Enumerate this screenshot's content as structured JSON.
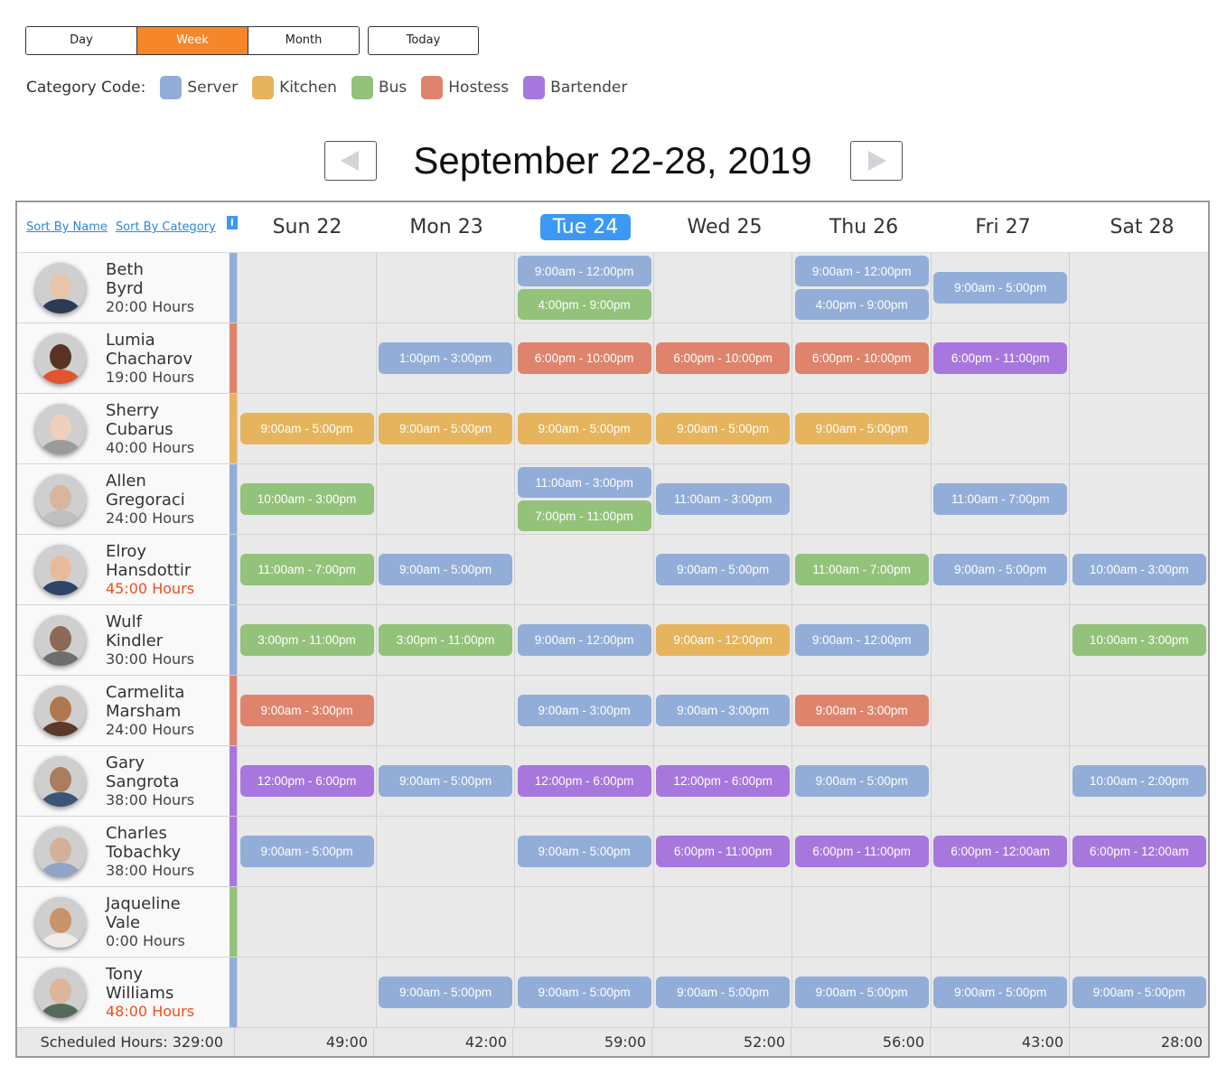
{
  "view_switch": {
    "options": [
      {
        "label": "Day",
        "active": false
      },
      {
        "label": "Week",
        "active": true
      },
      {
        "label": "Month",
        "active": false
      }
    ],
    "today_label": "Today"
  },
  "legend": {
    "title": "Category Code:",
    "items": [
      {
        "key": "server",
        "label": "Server",
        "color": "#92aed8"
      },
      {
        "key": "kitchen",
        "label": "Kitchen",
        "color": "#e5b45c"
      },
      {
        "key": "bus",
        "label": "Bus",
        "color": "#93c27a"
      },
      {
        "key": "hostess",
        "label": "Hostess",
        "color": "#df846c"
      },
      {
        "key": "bartender",
        "label": "Bartender",
        "color": "#a877de"
      }
    ]
  },
  "week_nav": {
    "title": "September 22-28, 2019",
    "prev_icon": "triangle-left-icon",
    "next_icon": "triangle-right-icon"
  },
  "header": {
    "sort_by_name": "Sort By Name",
    "sort_by_category": "Sort By Category",
    "info_icon": "i",
    "days": [
      {
        "label": "Sun 22",
        "today": false
      },
      {
        "label": "Mon 23",
        "today": false
      },
      {
        "label": "Tue 24",
        "today": true
      },
      {
        "label": "Wed 25",
        "today": false
      },
      {
        "label": "Thu 26",
        "today": false
      },
      {
        "label": "Fri 27",
        "today": false
      },
      {
        "label": "Sat 28",
        "today": false
      }
    ]
  },
  "colors": {
    "server": "#92aed8",
    "kitchen": "#e5b45c",
    "bus": "#93c27a",
    "hostess": "#df846c",
    "bartender": "#a877de",
    "accent_orange": "#f5862a",
    "today_blue": "#3b99f5",
    "overtime_red": "#f24c1e"
  },
  "employees": [
    {
      "first": "Beth",
      "last": "Byrd",
      "hours": "20:00 Hours",
      "overtime": false,
      "category": "server",
      "shifts": [
        [],
        [],
        [
          {
            "t": "9:00am - 12:00pm",
            "c": "server"
          },
          {
            "t": "4:00pm - 9:00pm",
            "c": "bus"
          }
        ],
        [],
        [
          {
            "t": "9:00am - 12:00pm",
            "c": "server"
          },
          {
            "t": "4:00pm - 9:00pm",
            "c": "server"
          }
        ],
        [
          {
            "t": "9:00am - 5:00pm",
            "c": "server"
          }
        ],
        []
      ]
    },
    {
      "first": "Lumia",
      "last": "Chacharov",
      "hours": "19:00 Hours",
      "overtime": false,
      "category": "hostess",
      "shifts": [
        [],
        [
          {
            "t": "1:00pm - 3:00pm",
            "c": "server"
          }
        ],
        [
          {
            "t": "6:00pm - 10:00pm",
            "c": "hostess"
          }
        ],
        [
          {
            "t": "6:00pm - 10:00pm",
            "c": "hostess"
          }
        ],
        [
          {
            "t": "6:00pm - 10:00pm",
            "c": "hostess"
          }
        ],
        [
          {
            "t": "6:00pm - 11:00pm",
            "c": "bartender"
          }
        ],
        []
      ]
    },
    {
      "first": "Sherry",
      "last": "Cubarus",
      "hours": "40:00 Hours",
      "overtime": false,
      "category": "kitchen",
      "shifts": [
        [
          {
            "t": "9:00am - 5:00pm",
            "c": "kitchen"
          }
        ],
        [
          {
            "t": "9:00am - 5:00pm",
            "c": "kitchen"
          }
        ],
        [
          {
            "t": "9:00am - 5:00pm",
            "c": "kitchen"
          }
        ],
        [
          {
            "t": "9:00am - 5:00pm",
            "c": "kitchen"
          }
        ],
        [
          {
            "t": "9:00am - 5:00pm",
            "c": "kitchen"
          }
        ],
        [],
        []
      ]
    },
    {
      "first": "Allen",
      "last": "Gregoraci",
      "hours": "24:00 Hours",
      "overtime": false,
      "category": "server",
      "shifts": [
        [
          {
            "t": "10:00am - 3:00pm",
            "c": "bus"
          }
        ],
        [],
        [
          {
            "t": "11:00am - 3:00pm",
            "c": "server"
          },
          {
            "t": "7:00pm - 11:00pm",
            "c": "bus"
          }
        ],
        [
          {
            "t": "11:00am - 3:00pm",
            "c": "server"
          }
        ],
        [],
        [
          {
            "t": "11:00am - 7:00pm",
            "c": "server"
          }
        ],
        []
      ]
    },
    {
      "first": "Elroy",
      "last": "Hansdottir",
      "hours": "45:00 Hours",
      "overtime": true,
      "category": "server",
      "shifts": [
        [
          {
            "t": "11:00am - 7:00pm",
            "c": "bus"
          }
        ],
        [
          {
            "t": "9:00am - 5:00pm",
            "c": "server"
          }
        ],
        [],
        [
          {
            "t": "9:00am - 5:00pm",
            "c": "server"
          }
        ],
        [
          {
            "t": "11:00am - 7:00pm",
            "c": "bus"
          }
        ],
        [
          {
            "t": "9:00am - 5:00pm",
            "c": "server"
          }
        ],
        [
          {
            "t": "10:00am - 3:00pm",
            "c": "server"
          }
        ]
      ]
    },
    {
      "first": "Wulf",
      "last": "Kindler",
      "hours": "30:00 Hours",
      "overtime": false,
      "category": "server",
      "shifts": [
        [
          {
            "t": "3:00pm - 11:00pm",
            "c": "bus"
          }
        ],
        [
          {
            "t": "3:00pm - 11:00pm",
            "c": "bus"
          }
        ],
        [
          {
            "t": "9:00am - 12:00pm",
            "c": "server"
          }
        ],
        [
          {
            "t": "9:00am - 12:00pm",
            "c": "kitchen"
          }
        ],
        [
          {
            "t": "9:00am - 12:00pm",
            "c": "server"
          }
        ],
        [],
        [
          {
            "t": "10:00am - 3:00pm",
            "c": "bus"
          }
        ]
      ]
    },
    {
      "first": "Carmelita",
      "last": "Marsham",
      "hours": "24:00 Hours",
      "overtime": false,
      "category": "hostess",
      "shifts": [
        [
          {
            "t": "9:00am - 3:00pm",
            "c": "hostess"
          }
        ],
        [],
        [
          {
            "t": "9:00am - 3:00pm",
            "c": "server"
          }
        ],
        [
          {
            "t": "9:00am - 3:00pm",
            "c": "server"
          }
        ],
        [
          {
            "t": "9:00am - 3:00pm",
            "c": "hostess"
          }
        ],
        [],
        []
      ]
    },
    {
      "first": "Gary",
      "last": "Sangrota",
      "hours": "38:00 Hours",
      "overtime": false,
      "category": "bartender",
      "shifts": [
        [
          {
            "t": "12:00pm - 6:00pm",
            "c": "bartender"
          }
        ],
        [
          {
            "t": "9:00am - 5:00pm",
            "c": "server"
          }
        ],
        [
          {
            "t": "12:00pm - 6:00pm",
            "c": "bartender"
          }
        ],
        [
          {
            "t": "12:00pm - 6:00pm",
            "c": "bartender"
          }
        ],
        [
          {
            "t": "9:00am - 5:00pm",
            "c": "server"
          }
        ],
        [],
        [
          {
            "t": "10:00am - 2:00pm",
            "c": "server"
          }
        ]
      ]
    },
    {
      "first": "Charles",
      "last": "Tobachky",
      "hours": "38:00 Hours",
      "overtime": false,
      "category": "bartender",
      "shifts": [
        [
          {
            "t": "9:00am - 5:00pm",
            "c": "server"
          }
        ],
        [],
        [
          {
            "t": "9:00am - 5:00pm",
            "c": "server"
          }
        ],
        [
          {
            "t": "6:00pm - 11:00pm",
            "c": "bartender"
          }
        ],
        [
          {
            "t": "6:00pm - 11:00pm",
            "c": "bartender"
          }
        ],
        [
          {
            "t": "6:00pm - 12:00am",
            "c": "bartender"
          }
        ],
        [
          {
            "t": "6:00pm - 12:00am",
            "c": "bartender"
          }
        ]
      ]
    },
    {
      "first": "Jaqueline",
      "last": "Vale",
      "hours": "0:00 Hours",
      "overtime": false,
      "category": "bus",
      "shifts": [
        [],
        [],
        [],
        [],
        [],
        [],
        []
      ]
    },
    {
      "first": "Tony",
      "last": "Williams",
      "hours": "48:00 Hours",
      "overtime": true,
      "category": "server",
      "shifts": [
        [],
        [
          {
            "t": "9:00am - 5:00pm",
            "c": "server"
          }
        ],
        [
          {
            "t": "9:00am - 5:00pm",
            "c": "server"
          }
        ],
        [
          {
            "t": "9:00am - 5:00pm",
            "c": "server"
          }
        ],
        [
          {
            "t": "9:00am - 5:00pm",
            "c": "server"
          }
        ],
        [
          {
            "t": "9:00am - 5:00pm",
            "c": "server"
          }
        ],
        [
          {
            "t": "9:00am - 5:00pm",
            "c": "server"
          }
        ]
      ]
    }
  ],
  "footer": {
    "total_label": "Scheduled Hours: 329:00",
    "day_totals": [
      "49:00",
      "42:00",
      "59:00",
      "52:00",
      "56:00",
      "43:00",
      "28:00"
    ]
  }
}
